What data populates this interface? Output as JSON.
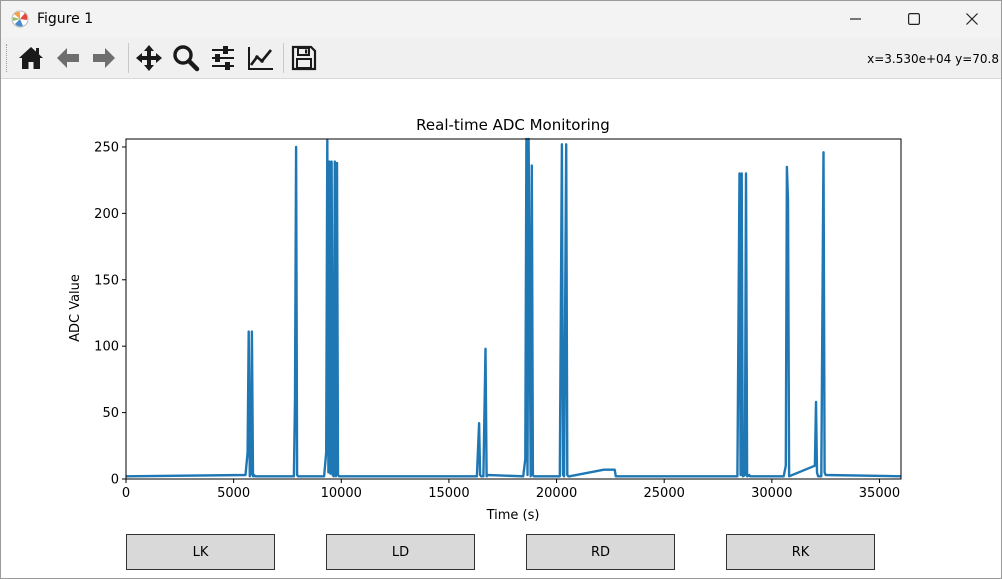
{
  "window": {
    "title": "Figure 1",
    "icons": [
      "matplotlib-logo",
      "minimize-icon",
      "maximize-icon",
      "close-icon"
    ]
  },
  "toolbar": {
    "buttons": [
      "home-icon",
      "back-icon",
      "forward-icon",
      "pan-icon",
      "zoom-icon",
      "configure-subplots-icon",
      "edit-axes-icon",
      "save-icon"
    ],
    "coords": "x=3.530e+04 y=70.8"
  },
  "chart_data": {
    "type": "line",
    "title": "Real-time ADC Monitoring",
    "xlabel": "Time (s)",
    "ylabel": "ADC Value",
    "xlim": [
      0,
      36000
    ],
    "ylim": [
      0,
      256
    ],
    "xticks": [
      0,
      5000,
      10000,
      15000,
      20000,
      25000,
      30000,
      35000
    ],
    "yticks": [
      0,
      50,
      100,
      150,
      200,
      250
    ],
    "grid": false,
    "legend": "none",
    "color": "#1f77b4",
    "series": [
      {
        "x": [
          0,
          5550,
          5650,
          5700,
          5750,
          5800,
          5850,
          5900,
          5950,
          6000,
          7800,
          7850,
          7900,
          7950,
          8000,
          9200,
          9300,
          9350,
          9400,
          9450,
          9500,
          9550,
          9600,
          9650,
          9700,
          9750,
          9800,
          9850,
          9900,
          16300,
          16400,
          16450,
          16500,
          16600,
          16700,
          16750,
          16800,
          18450,
          18550,
          18600,
          18650,
          18700,
          18800,
          18850,
          18900,
          18950,
          20150,
          20250,
          20300,
          20350,
          20450,
          20500,
          20550,
          20600,
          22200,
          22250,
          22500,
          22550,
          22700,
          22750,
          28400,
          28500,
          28550,
          28600,
          28650,
          28750,
          28800,
          28850,
          28950,
          29000,
          30550,
          30650,
          30700,
          30750,
          30800,
          32000,
          32050,
          32100,
          32150,
          32300,
          32400,
          32450,
          32500,
          36000
        ],
        "y": [
          2,
          3,
          20,
          111,
          2,
          4,
          111,
          2,
          3,
          2,
          2,
          60,
          250,
          3,
          2,
          2,
          20,
          255,
          5,
          239,
          4,
          239,
          3,
          2,
          239,
          2,
          238,
          3,
          2,
          2,
          42,
          3,
          2,
          2,
          98,
          2,
          3,
          2,
          15,
          256,
          3,
          256,
          2,
          236,
          3,
          2,
          2,
          252,
          3,
          2,
          252,
          3,
          2,
          2,
          7,
          7,
          7,
          7,
          7,
          2,
          2,
          230,
          3,
          230,
          2,
          3,
          230,
          2,
          3,
          2,
          2,
          10,
          235,
          210,
          2,
          10,
          58,
          5,
          2,
          2,
          246,
          5,
          3,
          2
        ]
      }
    ]
  },
  "buttons": {
    "lk": "LK",
    "ld": "LD",
    "rd": "RD",
    "rk": "RK"
  }
}
